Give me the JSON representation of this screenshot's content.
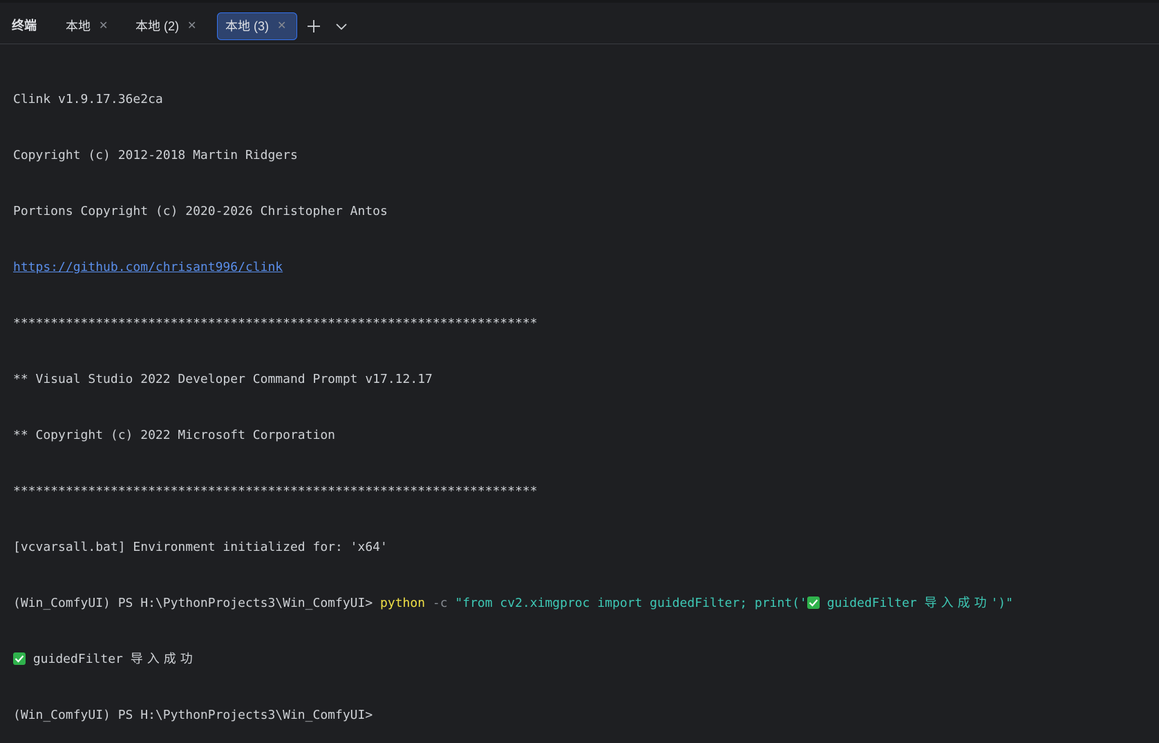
{
  "panel": {
    "title": "终端"
  },
  "tabs": [
    {
      "label": "本地",
      "active": false
    },
    {
      "label": "本地 (2)",
      "active": false
    },
    {
      "label": "本地 (3)",
      "active": true
    }
  ],
  "icons": {
    "tab_close": "close-icon",
    "new_tab": "plus-icon",
    "dropdown": "chevron-down-icon",
    "success": "check-mark-icon"
  },
  "terminal": {
    "banner": [
      "Clink v1.9.17.36e2ca",
      "Copyright (c) 2012-2018 Martin Ridgers",
      "Portions Copyright (c) 2020-2026 Christopher Antos"
    ],
    "link": "https://github.com/chrisant996/clink",
    "separator": "**********************************************************************",
    "vs_lines": [
      "** Visual Studio 2022 Developer Command Prompt v17.12.17",
      "** Copyright (c) 2022 Microsoft Corporation"
    ],
    "env_line": "[vcvarsall.bat] Environment initialized for: 'x64'",
    "prompt": "(Win_ComfyUI) PS H:\\PythonProjects3\\Win_ComfyUI> ",
    "command": {
      "exe": "python",
      "flag": " -c ",
      "arg_before_icon": "\"from cv2.ximgproc import guidedFilter; print('",
      "arg_after_icon": " guidedFilter ",
      "arg_cjk": "导入成功",
      "arg_end": "')\""
    },
    "output": {
      "text": " guidedFilter ",
      "cjk": "导入成功"
    },
    "final_prompt": "(Win_ComfyUI) PS H:\\PythonProjects3\\Win_ComfyUI>"
  },
  "colors": {
    "background": "#1e1f22",
    "text": "#cfd2d6",
    "link": "#5a8eea",
    "command": "#f0e046",
    "string": "#3ec9b6",
    "active_tab_bg": "#2e436e",
    "active_tab_border": "#3574f0",
    "check_green": "#2fb24c"
  }
}
